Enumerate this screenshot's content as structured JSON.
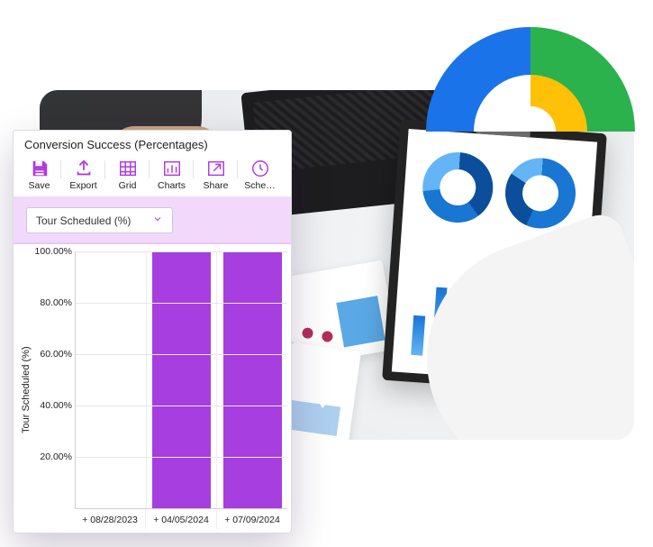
{
  "panel": {
    "title": "Conversion Success (Percentages)",
    "toolbar": {
      "save": "Save",
      "export": "Export",
      "grid": "Grid",
      "charts": "Charts",
      "share": "Share",
      "schedule": "Sche…"
    },
    "dropdown": {
      "selected": "Tour Scheduled (%)"
    },
    "ylabel": "Tour Scheduled (%)"
  },
  "chart_data": {
    "type": "bar",
    "categories": [
      "+ 08/28/2023",
      "+ 04/05/2024",
      "+ 07/09/2024"
    ],
    "values": [
      0,
      100,
      100
    ],
    "title": "Conversion Success (Percentages)",
    "xlabel": "",
    "ylabel": "Tour Scheduled (%)",
    "ylim": [
      0,
      100
    ],
    "yticks": [
      "20.00%",
      "40.00%",
      "60.00%",
      "80.00%",
      "100.00%"
    ]
  },
  "colors": {
    "accent": "#b339e0",
    "bar": "#a63ee0"
  }
}
